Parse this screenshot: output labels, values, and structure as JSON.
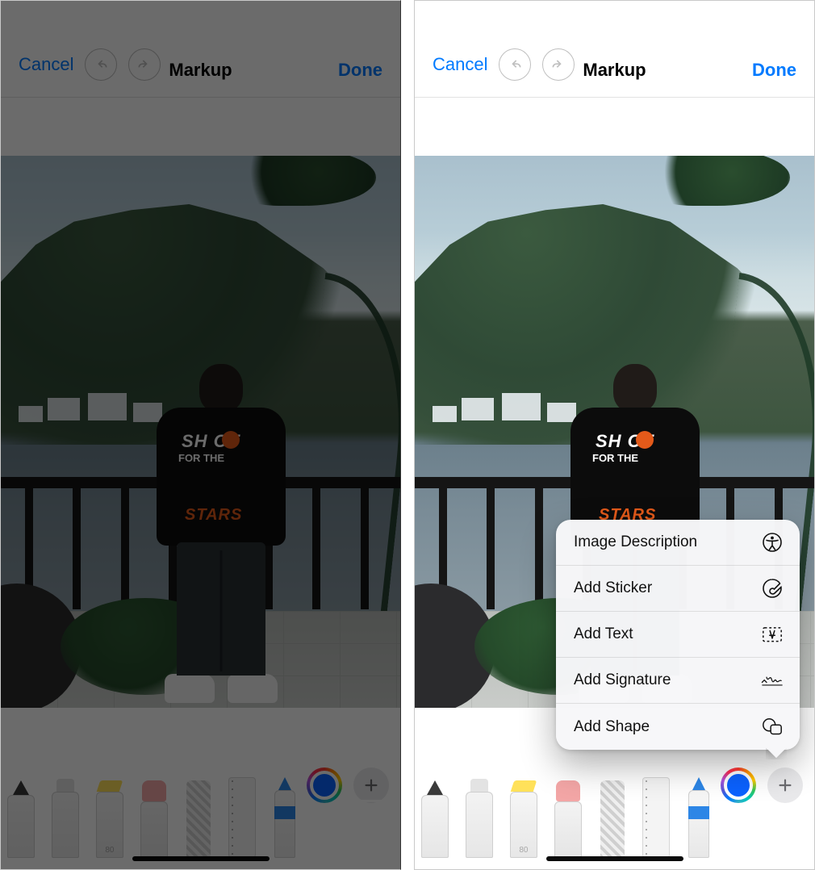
{
  "header": {
    "cancel": "Cancel",
    "title": "Markup",
    "done": "Done"
  },
  "shirt": {
    "line1": "SH  OT",
    "line2": "FOR     THE",
    "line3": "STARS"
  },
  "tools": {
    "highlighter_label": "80"
  },
  "popup": {
    "items": [
      {
        "label": "Image Description",
        "icon": "accessibility-icon"
      },
      {
        "label": "Add Sticker",
        "icon": "sticker-icon"
      },
      {
        "label": "Add Text",
        "icon": "textbox-icon"
      },
      {
        "label": "Add Signature",
        "icon": "signature-icon"
      },
      {
        "label": "Add Shape",
        "icon": "shapes-icon"
      }
    ]
  },
  "colors": {
    "ios_blue": "#007aff"
  }
}
